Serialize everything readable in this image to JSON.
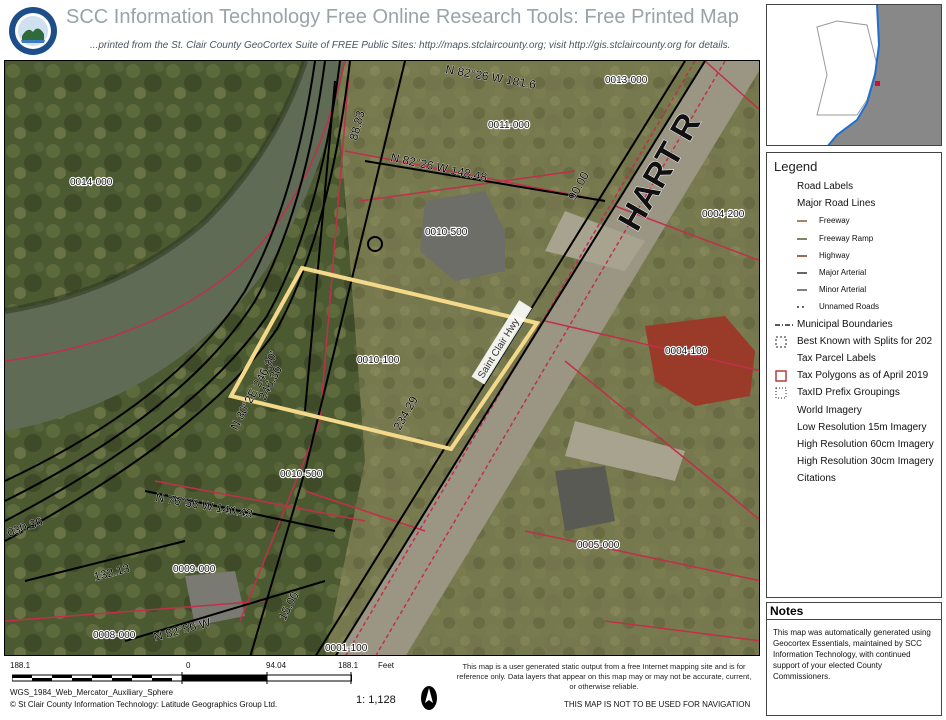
{
  "header": {
    "title": "SCC Information Technology Free Online Research Tools: Free Printed Map",
    "subtitle": "...printed from the St. Clair County GeoCortex Suite of FREE Public Sites: http://maps.stclaircounty.org; visit http://gis.stclaircounty.org for details."
  },
  "map": {
    "parcels": [
      {
        "label": "0013-000"
      },
      {
        "label": "0011-000"
      },
      {
        "label": "0014-000"
      },
      {
        "label": "0010-500"
      },
      {
        "label": "0004-200"
      },
      {
        "label": "0010-100"
      },
      {
        "label": "0004-100"
      },
      {
        "label": "0010-500"
      },
      {
        "label": "0005-000"
      },
      {
        "label": "0009-000"
      },
      {
        "label": "0008-000"
      },
      {
        "label": "0001-100"
      }
    ],
    "dimensions": {
      "d1": "N 30°2E 246.30'",
      "d2": "246.30",
      "d3": "234.29",
      "d4": "90.00",
      "d5": "132.13",
      "d6": "15.00",
      "d7": "030.36",
      "d8": "N 82°26 W 148.48",
      "d9": "N 82°26 W 181.6",
      "d10": "88.83",
      "d11": "N 76°56 W 140.43",
      "d12": "N 82°56 W"
    },
    "road_label": "Saint Clair Hwy",
    "road_name_large": "HART R",
    "colors": {
      "selected_parcel": "#f5d98a",
      "parcel_lines": "#c0304a",
      "lot_lines": "#000000"
    }
  },
  "legend": {
    "title": "Legend",
    "items": [
      {
        "label": "Road Labels",
        "sym": "none",
        "sub": false
      },
      {
        "label": "Major Road Lines",
        "sym": "none",
        "sub": false
      },
      {
        "label": "Freeway",
        "sym": "line",
        "color": "#8a5a2a",
        "sub": true
      },
      {
        "label": "Freeway Ramp",
        "sym": "line",
        "color": "#5a5a2a",
        "sub": true
      },
      {
        "label": "Highway",
        "sym": "line",
        "color": "#7a3a1a",
        "sub": true
      },
      {
        "label": "Major Arterial",
        "sym": "line",
        "color": "#333333",
        "sub": true
      },
      {
        "label": "Minor Arterial",
        "sym": "line",
        "color": "#555555",
        "sub": true
      },
      {
        "label": "Unnamed Roads",
        "sym": "dash",
        "color": "#333333",
        "sub": true
      },
      {
        "label": "Municipal Boundaries",
        "sym": "dashdot",
        "color": "#222222",
        "sub": false
      },
      {
        "label": "Best Known with Splits for 202",
        "sym": "boxdash",
        "color": "#222222",
        "sub": false
      },
      {
        "label": "Tax Parcel Labels",
        "sym": "none",
        "sub": false
      },
      {
        "label": "Tax Polygons as of April 2019",
        "sym": "box",
        "color": "#b03030",
        "sub": false
      },
      {
        "label": "TaxID Prefix Groupings",
        "sym": "boxdot",
        "color": "#222222",
        "sub": false
      },
      {
        "label": "World Imagery",
        "sym": "none",
        "sub": false
      },
      {
        "label": "Low Resolution 15m Imagery",
        "sym": "none",
        "sub": false
      },
      {
        "label": "High Resolution 60cm Imagery",
        "sym": "none",
        "sub": false
      },
      {
        "label": "High Resolution 30cm Imagery",
        "sym": "none",
        "sub": false
      },
      {
        "label": "Citations",
        "sym": "none",
        "sub": false
      }
    ]
  },
  "notes": {
    "title": "Notes",
    "body": "This map was automatically generated using Geocortex Essentials, maintained by SCC Information Technology, with continued support of your elected County Commissioners."
  },
  "footer": {
    "scale_left": "188.1",
    "scale_zero": "0",
    "scale_mid": "94.04",
    "scale_right": "188.1",
    "scale_unit": "Feet",
    "projection": "WGS_1984_Web_Mercator_Auxiliary_Sphere",
    "copyright": "© St Clair County Information Technology: Latitude Geographics Group Ltd.",
    "scale_ratio": "1: 1,128",
    "disclaimer": "This map is a user generated static output from a free Internet mapping site and is for reference only. Data layers that appear on this map may or may not be accurate, current, or otherwise reliable.",
    "nav_warning": "THIS MAP IS NOT TO BE USED FOR NAVIGATION"
  }
}
